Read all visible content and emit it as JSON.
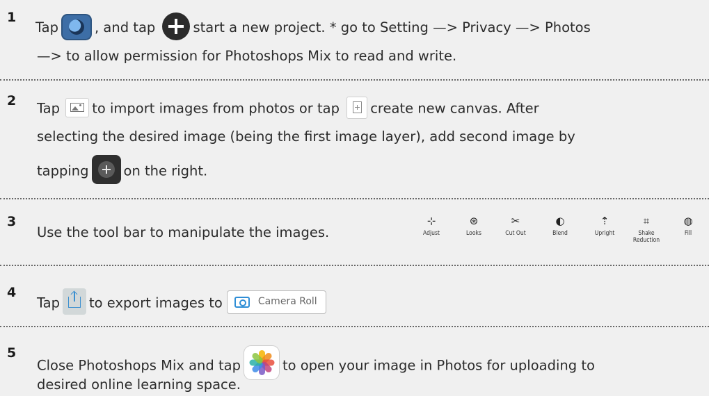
{
  "steps": [
    {
      "number": "1",
      "line1": {
        "a": "Tap",
        "b": ", and tap",
        "c": "start  a new project. * go to Setting —> Privacy —> Photos"
      },
      "line2": "—> to allow  permission for Photoshops Mix to read and write."
    },
    {
      "number": "2",
      "line1": {
        "a": "Tap",
        "b": "to import images from photos or tap",
        "c": "create new canvas.  After"
      },
      "line2": "selecting the desired image (being the first image layer), add second image by",
      "line3": {
        "a": "tapping",
        "b": "on the right."
      }
    },
    {
      "number": "3",
      "text": "Use the tool bar to manipulate the images.",
      "toolbar": [
        {
          "label": "Adjust",
          "icon": "adjust-icon",
          "glyph": "⊹"
        },
        {
          "label": "Looks",
          "icon": "looks-icon",
          "glyph": "⊛"
        },
        {
          "label": "Cut Out",
          "icon": "scissors-icon",
          "glyph": "✂"
        },
        {
          "label": "Blend",
          "icon": "blend-icon",
          "glyph": "◐"
        },
        {
          "label": "Upright",
          "icon": "upright-icon",
          "glyph": "⇡"
        },
        {
          "label": "Shake\nReduction",
          "label_line1": "Shake",
          "label_line2": "Reduction",
          "icon": "shake-reduction-icon",
          "glyph": "⌗"
        },
        {
          "label": "Fill",
          "icon": "fill-icon",
          "glyph": "◍"
        }
      ]
    },
    {
      "number": "4",
      "a": "Tap",
      "b": "to export images to",
      "camera_roll": "Camera Roll"
    },
    {
      "number": "5",
      "line1": {
        "a": "Close Photoshops Mix and tap",
        "b": "to open your image in Photos for uploading to"
      },
      "line2": "desired online learning space."
    }
  ],
  "colors": {
    "background": "#f0f0f0",
    "text": "#2b2b2b",
    "accent_blue": "#2f8ed6",
    "separator": "#666666"
  }
}
